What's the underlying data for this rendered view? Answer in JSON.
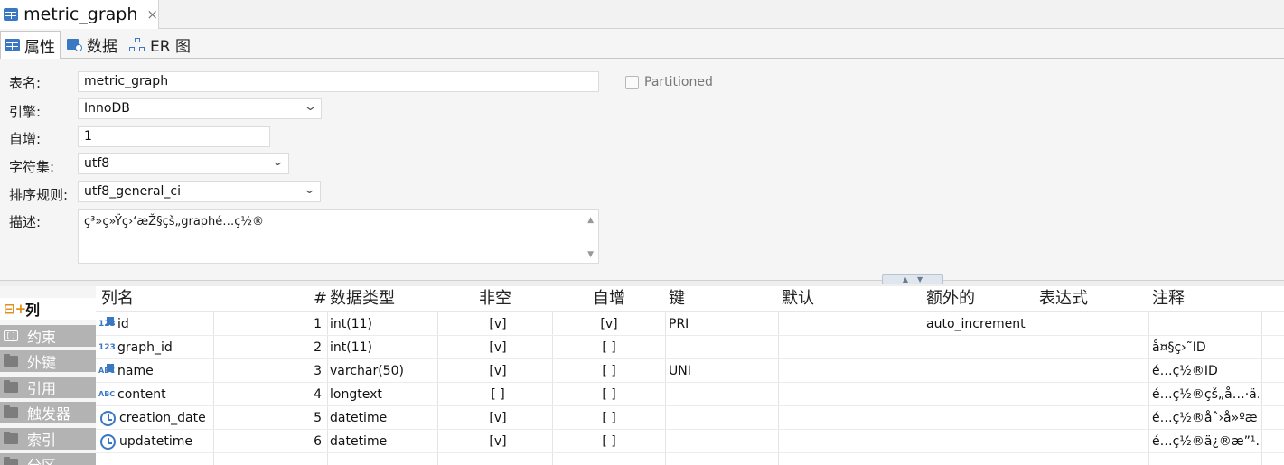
{
  "editor_tab": {
    "title": "metric_graph",
    "close": "×"
  },
  "subtabs": [
    {
      "label": "属性",
      "icon": "table-icon"
    },
    {
      "label": "数据",
      "icon": "data-icon"
    },
    {
      "label": "ER 图",
      "icon": "er-diagram-icon"
    }
  ],
  "properties": {
    "table_name": {
      "label": "表名:",
      "value": "metric_graph"
    },
    "engine": {
      "label": "引擎:",
      "value": "InnoDB"
    },
    "auto_increment": {
      "label": "自增:",
      "value": "1"
    },
    "charset": {
      "label": "字符集:",
      "value": "utf8"
    },
    "collation": {
      "label": "排序规则:",
      "value": "utf8_general_ci"
    },
    "description": {
      "label": "描述:",
      "value": "ç³»ç»Ÿç›‘æŽ§çš„graphé…ç½®"
    },
    "partitioned": {
      "label": "Partitioned",
      "checked": false
    }
  },
  "sidenav": [
    {
      "label": "列",
      "active": true,
      "icon": "columns-icon"
    },
    {
      "label": "约束",
      "active": false,
      "icon": "constraint-icon"
    },
    {
      "label": "外键",
      "active": false,
      "icon": "folder-icon"
    },
    {
      "label": "引用",
      "active": false,
      "icon": "folder-icon"
    },
    {
      "label": "触发器",
      "active": false,
      "icon": "folder-icon"
    },
    {
      "label": "索引",
      "active": false,
      "icon": "folder-icon"
    },
    {
      "label": "分区",
      "active": false,
      "icon": "folder-icon"
    }
  ],
  "grid": {
    "headers": {
      "name": "列名",
      "num": "#",
      "type": "数据类型",
      "notnull": "非空",
      "autoinc": "自增",
      "key": "键",
      "default": "默认",
      "extra": "额外的",
      "expression": "表达式",
      "comment": "注释"
    },
    "rows": [
      {
        "icon": "numeric-key-icon",
        "name": "id",
        "num": "1",
        "type": "int(11)",
        "notnull": "[v]",
        "autoinc": "[v]",
        "key": "PRI",
        "default": "",
        "extra": "auto_increment",
        "expression": "",
        "comment": ""
      },
      {
        "icon": "numeric-icon",
        "name": "graph_id",
        "num": "2",
        "type": "int(11)",
        "notnull": "[v]",
        "autoinc": "[ ]",
        "key": "",
        "default": "",
        "extra": "",
        "expression": "",
        "comment": "å¤§ç›˜ID"
      },
      {
        "icon": "text-key-icon",
        "name": "name",
        "num": "3",
        "type": "varchar(50)",
        "notnull": "[v]",
        "autoinc": "[ ]",
        "key": "UNI",
        "default": "",
        "extra": "",
        "expression": "",
        "comment": "é…ç½®ID"
      },
      {
        "icon": "text-icon",
        "name": "content",
        "num": "4",
        "type": "longtext",
        "notnull": "[ ]",
        "autoinc": "[ ]",
        "key": "",
        "default": "",
        "extra": "",
        "expression": "",
        "comment": "é…ç½®çš„å…·ä..."
      },
      {
        "icon": "clock-icon",
        "name": "creation_date",
        "num": "5",
        "type": "datetime",
        "notnull": "[v]",
        "autoinc": "[ ]",
        "key": "",
        "default": "",
        "extra": "",
        "expression": "",
        "comment": "é…ç½®åˆ›å»ºæ..."
      },
      {
        "icon": "clock-icon",
        "name": "updatetime",
        "num": "6",
        "type": "datetime",
        "notnull": "[v]",
        "autoinc": "[ ]",
        "key": "",
        "default": "",
        "extra": "",
        "expression": "",
        "comment": "é…ç½®ä¿®æ”¹..."
      }
    ]
  }
}
